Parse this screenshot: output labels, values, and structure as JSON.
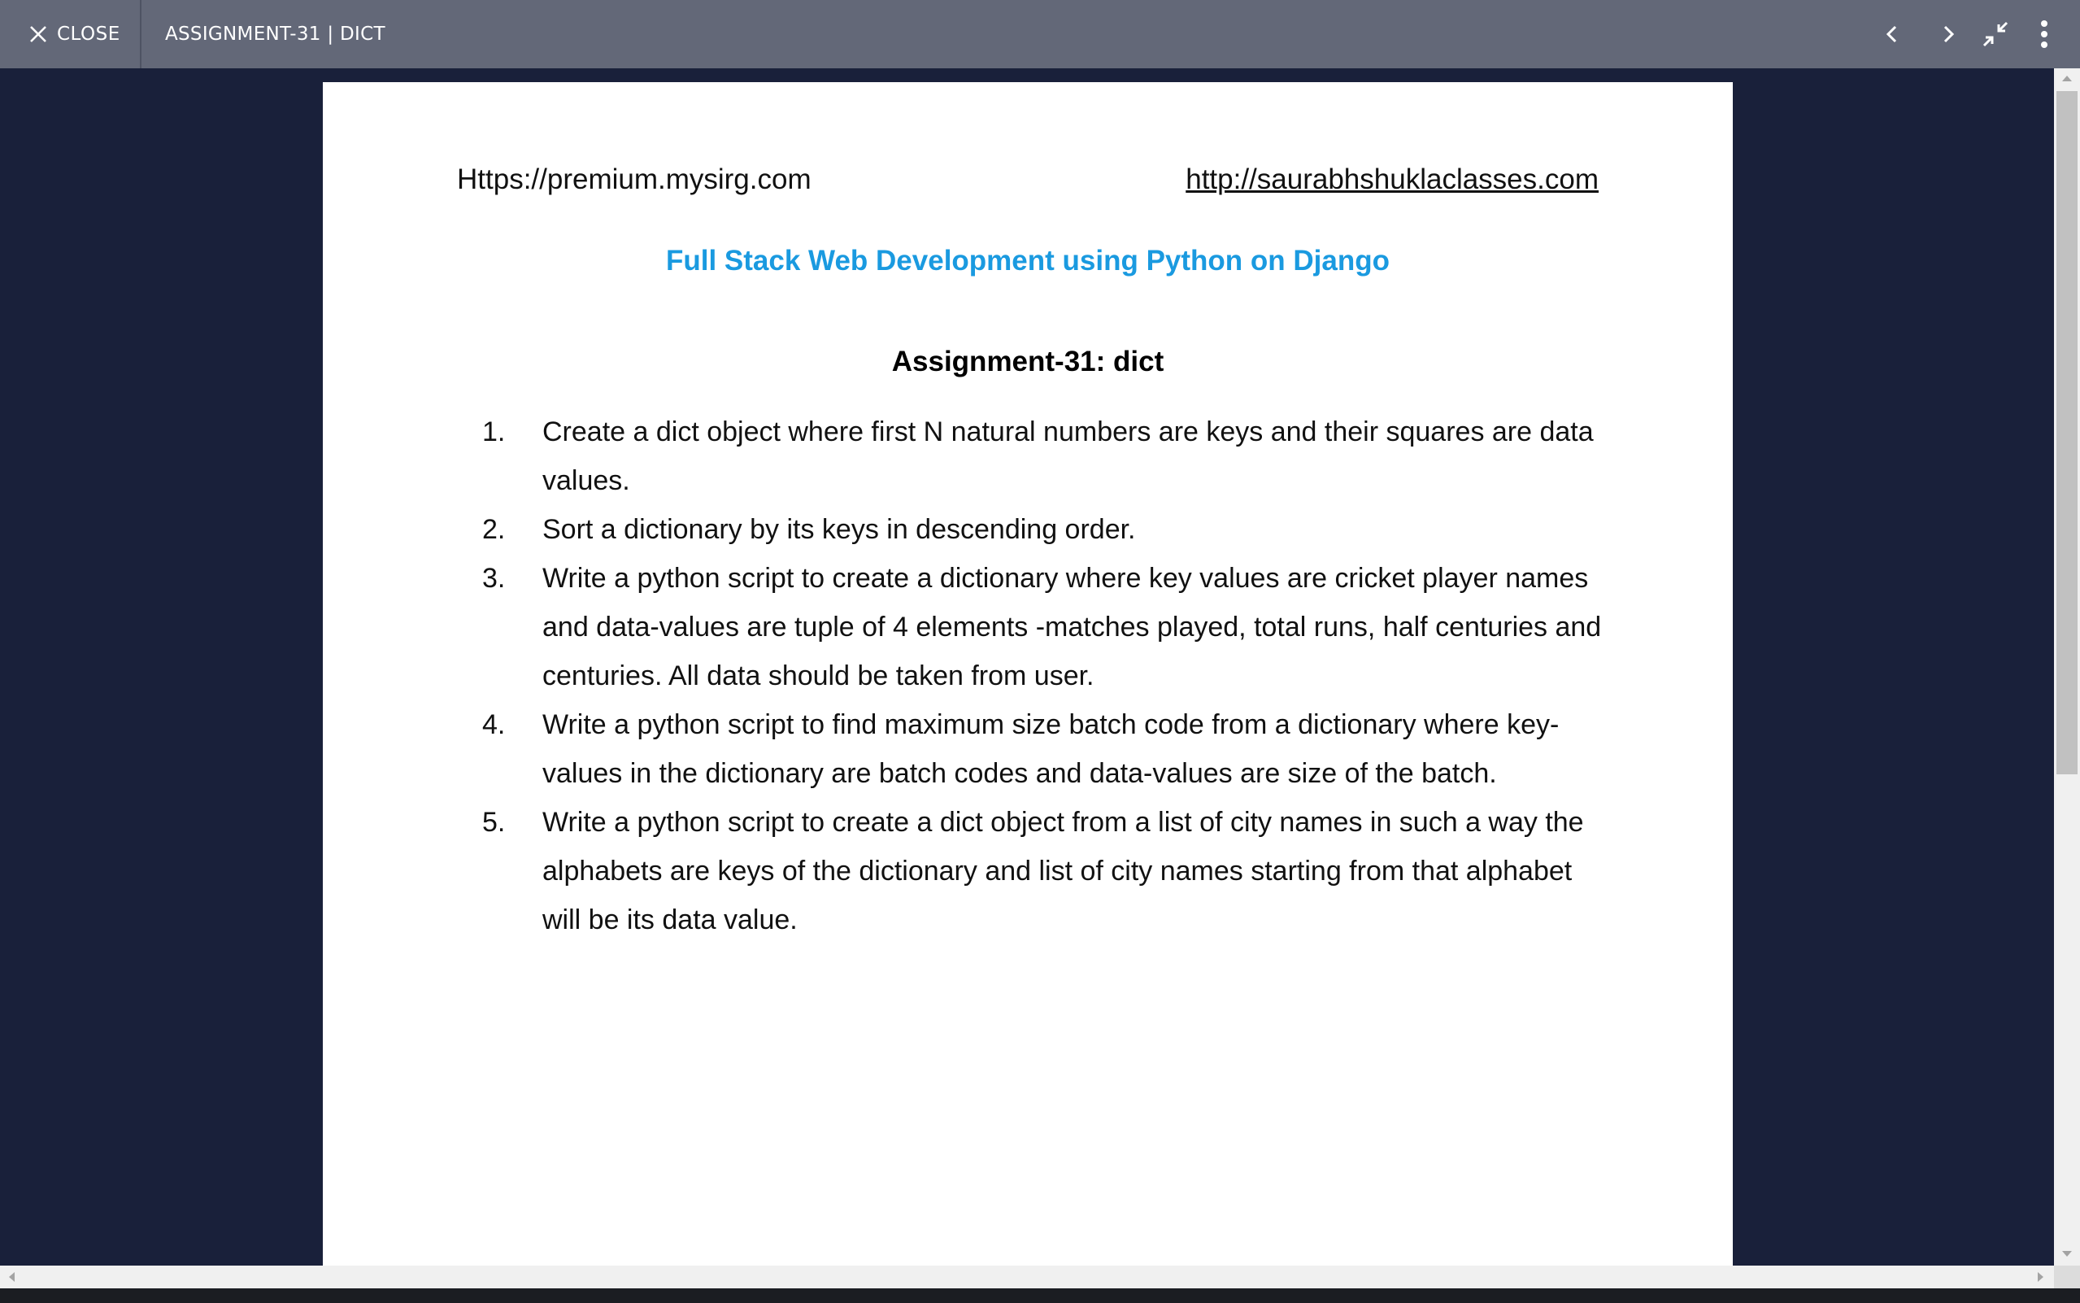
{
  "topbar": {
    "close_label": "CLOSE",
    "title": "ASSIGNMENT-31 | DICT",
    "icons": [
      "close-icon",
      "chevron-left-icon",
      "chevron-right-icon",
      "exit-fullscreen-icon",
      "more-vert-icon"
    ]
  },
  "document": {
    "header_left": "Https://premium.mysirg.com",
    "header_right": "http://saurabhshuklaclasses.com",
    "course_title": "Full Stack Web Development using Python on Django",
    "assignment_title": "Assignment-31: dict",
    "questions": [
      {
        "num": "1.",
        "text": "Create a dict object where first N natural numbers are keys and their squares are data values."
      },
      {
        "num": "2.",
        "text": "Sort a dictionary by its keys in descending order."
      },
      {
        "num": "3.",
        "text": "Write a python script to create a dictionary where key values are cricket player names and data-values are tuple of 4 elements -matches played, total runs, half centuries and centuries. All data should be taken from user."
      },
      {
        "num": "4.",
        "text": "Write a python script to find maximum size batch code from a dictionary where key-values in the dictionary are batch codes and data-values are size of the batch."
      },
      {
        "num": "5.",
        "text": "Write a python script to create a dict object from a list of city names in such a way the alphabets are keys of the dictionary and list of city names starting from that alphabet will be its data value."
      }
    ]
  },
  "colors": {
    "topbar": "#636878",
    "viewer_bg": "#19203a",
    "course_title": "#1a9ae0"
  }
}
